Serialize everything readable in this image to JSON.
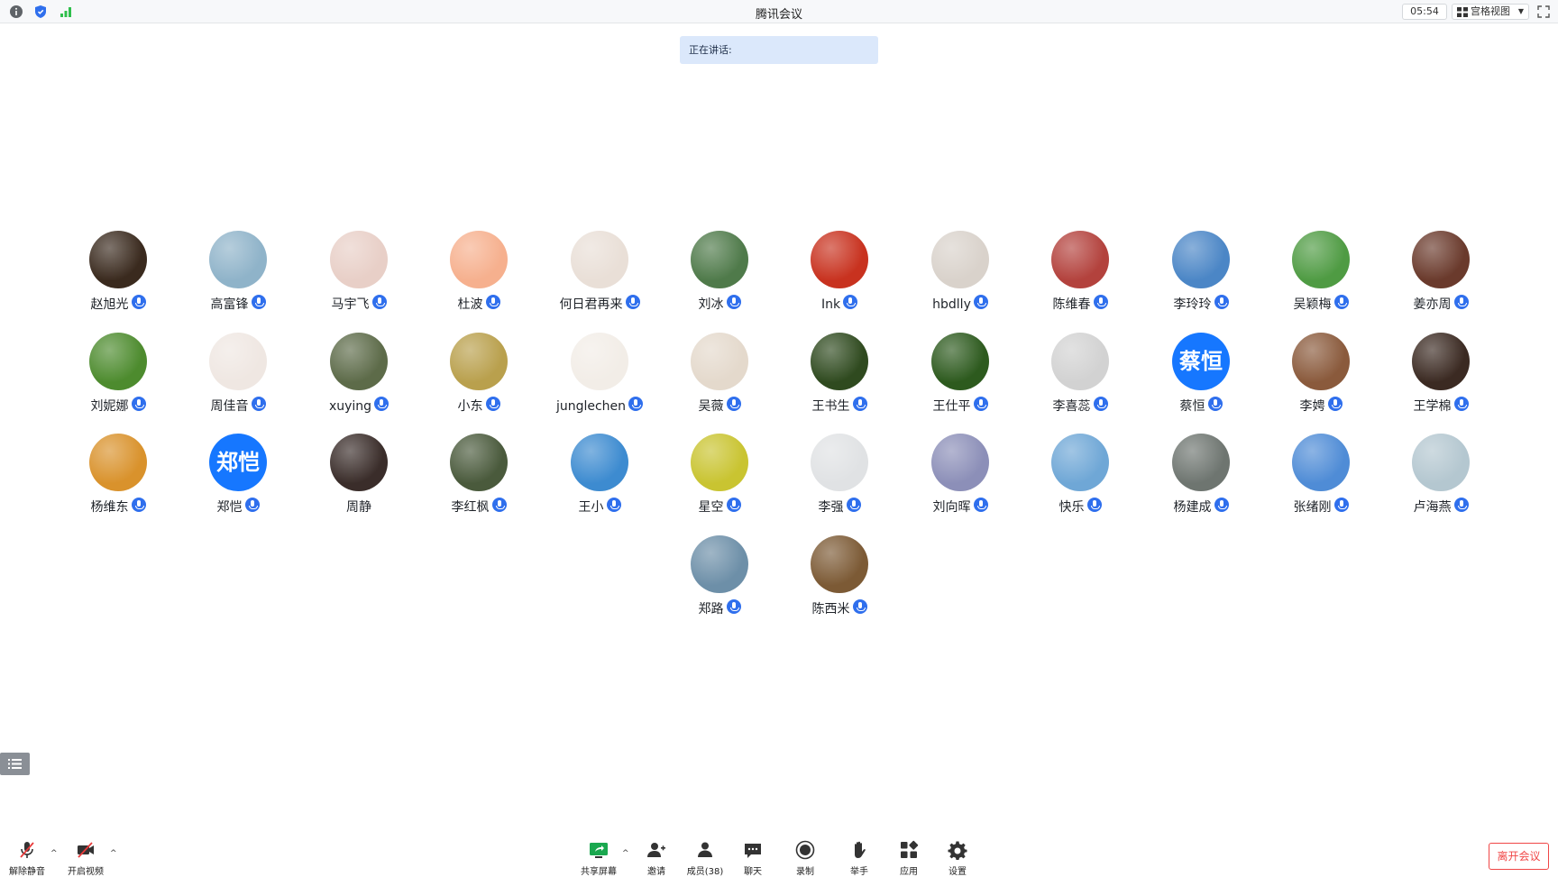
{
  "app": {
    "title": "腾讯会议",
    "timer": "05:54",
    "view_mode": "宫格视图"
  },
  "speaking": {
    "label": "正在讲话:"
  },
  "participants": [
    {
      "name": "赵旭光",
      "bg": "#3a2a1e"
    },
    {
      "name": "高富锋",
      "bg": "#8fb3c9"
    },
    {
      "name": "马宇飞",
      "bg": "#e8cfc7"
    },
    {
      "name": "杜波",
      "bg": "#f6b08e"
    },
    {
      "name": "何日君再来",
      "bg": "#e9dfd7"
    },
    {
      "name": "刘冰",
      "bg": "#4f7a4a"
    },
    {
      "name": "Ink",
      "bg": "#c8321f"
    },
    {
      "name": "hbdlly",
      "bg": "#d9d2cb"
    },
    {
      "name": "陈维春",
      "bg": "#b3423d"
    },
    {
      "name": "李玲玲",
      "bg": "#4b86c6"
    },
    {
      "name": "吴颖梅",
      "bg": "#4f9b43"
    },
    {
      "name": "姜亦周",
      "bg": "#6a3a2c"
    },
    {
      "name": "刘妮娜",
      "bg": "#4d8b2e"
    },
    {
      "name": "周佳音",
      "bg": "#efe7e2"
    },
    {
      "name": "xuying",
      "bg": "#5d6b49"
    },
    {
      "name": "小东",
      "bg": "#b9a04d"
    },
    {
      "name": "junglechen",
      "bg": "#f2ede7"
    },
    {
      "name": "吴薇",
      "bg": "#e4d9cc"
    },
    {
      "name": "王书生",
      "bg": "#2f4a1f"
    },
    {
      "name": "王仕平",
      "bg": "#2d5a1e"
    },
    {
      "name": "李喜蕊",
      "bg": "#d2d2d2"
    },
    {
      "name": "蔡恒",
      "text": "蔡恒"
    },
    {
      "name": "李娉",
      "bg": "#8a5a3c"
    },
    {
      "name": "王学棉",
      "bg": "#3b2a22"
    },
    {
      "name": "杨维东",
      "bg": "#d9922c"
    },
    {
      "name": "郑恺",
      "text": "郑恺"
    },
    {
      "name": "周静",
      "bg": "#3a2d2a"
    },
    {
      "name": "李红枫",
      "bg": "#4a5a3c"
    },
    {
      "name": "王小",
      "bg": "#3d8bd0"
    },
    {
      "name": "星空",
      "bg": "#c9c431"
    },
    {
      "name": "李强",
      "bg": "#e0e2e4"
    },
    {
      "name": "刘向晖",
      "bg": "#8c8fb8"
    },
    {
      "name": "快乐",
      "bg": "#6fa7d6"
    },
    {
      "name": "杨建成",
      "bg": "#6e7570"
    },
    {
      "name": "张绪刚",
      "bg": "#4f8cd6"
    },
    {
      "name": "卢海燕",
      "bg": "#b4c7d0"
    },
    {
      "name": "郑路",
      "bg": "#6d8fa8"
    },
    {
      "name": "陈西米",
      "bg": "#7c5a35"
    }
  ],
  "toolbar": {
    "unmute": "解除静音",
    "video": "开启视频",
    "share": "共享屏幕",
    "invite": "邀请",
    "members": "成员(38)",
    "chat": "聊天",
    "record": "录制",
    "raise_hand": "举手",
    "apps": "应用",
    "settings": "设置",
    "leave": "离开会议"
  }
}
